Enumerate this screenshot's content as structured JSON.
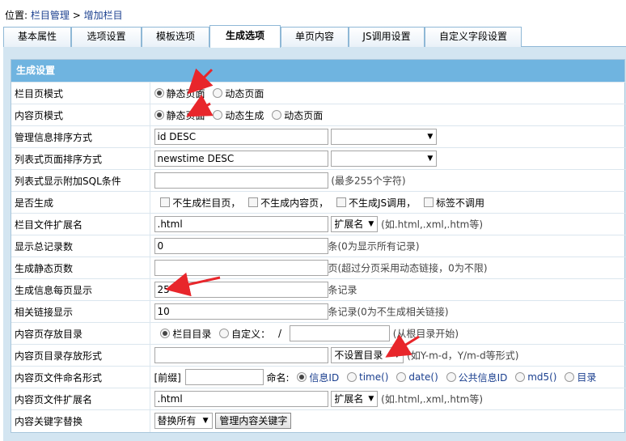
{
  "breadcrumb": {
    "prefix": "位置:",
    "parent": "栏目管理",
    "sep": ">",
    "current": "增加栏目"
  },
  "tabs": [
    "基本属性",
    "选项设置",
    "模板选项",
    "生成选项",
    "单页内容",
    "JS调用设置",
    "自定义字段设置"
  ],
  "section_title": "生成设置",
  "rows": {
    "list_mode": {
      "label": "栏目页模式",
      "opt1": "静态页面",
      "opt2": "动态页面"
    },
    "content_mode": {
      "label": "内容页模式",
      "opt1": "静态页面",
      "opt2": "动态生成",
      "opt3": "动态页面"
    },
    "manage_order": {
      "label": "管理信息排序方式",
      "value": "id DESC"
    },
    "list_order": {
      "label": "列表式页面排序方式",
      "value": "newstime DESC"
    },
    "list_sql": {
      "label": "列表式显示附加SQL条件",
      "value": "",
      "hint": "(最多255个字符)"
    },
    "generate": {
      "label": "是否生成",
      "c1": "不生成栏目页，",
      "c2": "不生成内容页，",
      "c3": "不生成JS调用，",
      "c4": "标签不调用"
    },
    "list_ext": {
      "label": "栏目文件扩展名",
      "value": ".html",
      "select": "扩展名",
      "hint": "(如.html,.xml,.htm等)"
    },
    "total_records": {
      "label": "显示总记录数",
      "value": "0",
      "hint": "条(0为显示所有记录)"
    },
    "static_pages": {
      "label": "生成静态页数",
      "value": "",
      "hint": "页(超过分页采用动态链接，0为不限)"
    },
    "per_page": {
      "label": "生成信息每页显示",
      "value": "25",
      "hint": "条记录"
    },
    "related": {
      "label": "相关链接显示",
      "value": "10",
      "hint": "条记录(0为不生成相关链接)"
    },
    "content_dir": {
      "label": "内容页存放目录",
      "opt1": "栏目目录",
      "opt2": "自定义：",
      "slash": "/",
      "value": "",
      "hint": "(从根目录开始)"
    },
    "dir_format": {
      "label": "内容页目录存放形式",
      "value": "",
      "select": "不设置目录",
      "hint": "(如Y-m-d，Y/m-d等形式)"
    },
    "file_naming": {
      "label": "内容页文件命名形式",
      "prefix": "[前缀]",
      "value": "",
      "name_label": "命名:",
      "o1": "信息ID",
      "o2": "time()",
      "o3": "date()",
      "o4": "公共信息ID",
      "o5": "md5()",
      "o6": "目录"
    },
    "content_ext": {
      "label": "内容页文件扩展名",
      "value": ".html",
      "select": "扩展名",
      "hint": "(如.html,.xml,.htm等)"
    },
    "keyword_replace": {
      "label": "内容关键字替换",
      "select": "替换所有",
      "button": "管理内容关键字"
    }
  },
  "colors": {
    "header_bg": "#6fb4e0",
    "panel_bg": "#d3e5f1",
    "link": "#1a3f8f",
    "annotation": "#e8262b"
  }
}
